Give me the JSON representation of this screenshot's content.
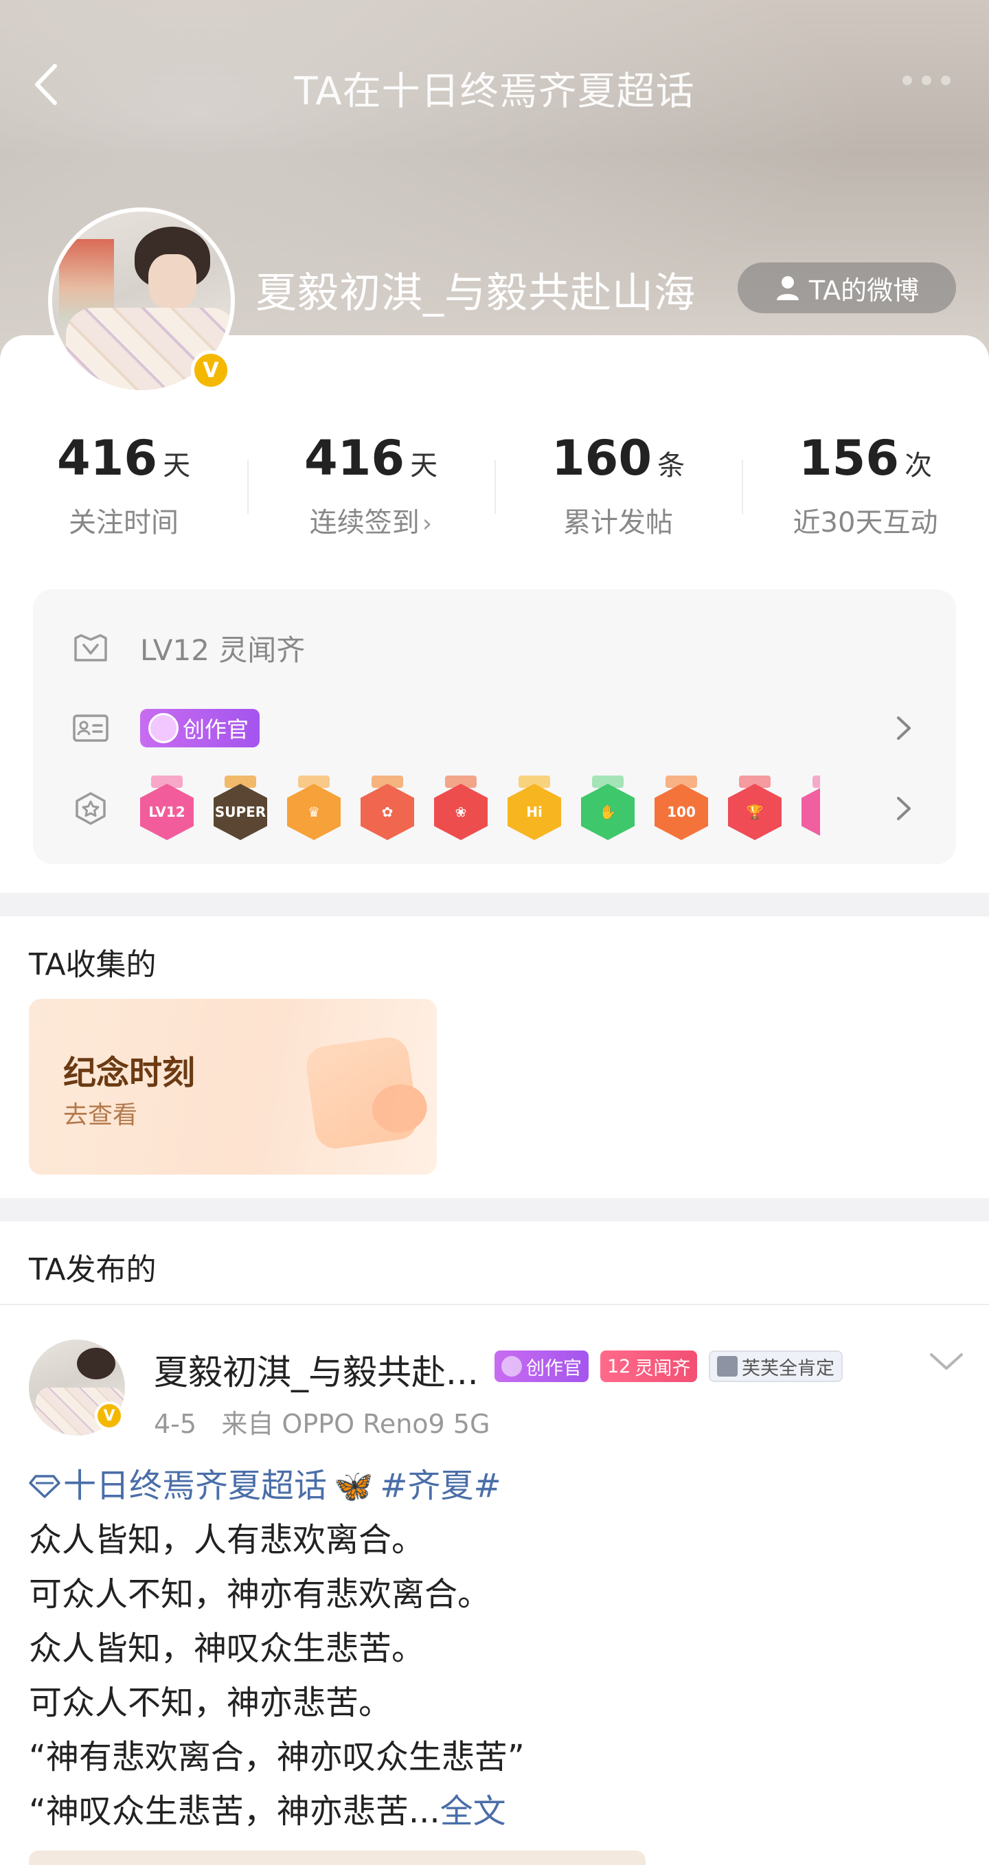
{
  "header": {
    "title": "TA在十日终焉齐夏超话"
  },
  "profile": {
    "name": "夏毅初淇_与毅共赴山海",
    "weibo_button_label": "TA的微博",
    "verified_mark": "V"
  },
  "stats": [
    {
      "value": "416",
      "unit": "天",
      "label": "关注时间",
      "has_arrow": false
    },
    {
      "value": "416",
      "unit": "天",
      "label": "连续签到",
      "has_arrow": true,
      "arrow": "›"
    },
    {
      "value": "160",
      "unit": "条",
      "label": "累计发帖",
      "has_arrow": false
    },
    {
      "value": "156",
      "unit": "次",
      "label": "近30天互动",
      "has_arrow": false
    }
  ],
  "level": {
    "text": "LV12 灵闻齐",
    "creator_tag": "创作官",
    "medals": [
      {
        "icon": "lv12-medal",
        "text": "LV12",
        "color": "#f25c9a",
        "ribbon": "#f7a7c8"
      },
      {
        "icon": "super-crown-medal",
        "text": "SUPER",
        "color": "#5a4632",
        "ribbon": "#f2b96a"
      },
      {
        "icon": "crown-medal",
        "text": "♛",
        "color": "#f6a13a",
        "ribbon": "#f9c98a"
      },
      {
        "icon": "mascot-medal",
        "text": "✿",
        "color": "#f0664e",
        "ribbon": "#f5b37f"
      },
      {
        "icon": "mascot-girl-medal",
        "text": "❀",
        "color": "#ee4d4d",
        "ribbon": "#f3a58a"
      },
      {
        "icon": "hi-medal",
        "text": "Hi",
        "color": "#f7b51f",
        "ribbon": "#f9d27e"
      },
      {
        "icon": "hand-medal",
        "text": "✋",
        "color": "#3fc76b",
        "ribbon": "#a4e4b7"
      },
      {
        "icon": "100-days-medal",
        "text": "100",
        "color": "#f4733a",
        "ribbon": "#f8b184"
      },
      {
        "icon": "trophy-medal",
        "text": "🏆",
        "color": "#ef4c55",
        "ribbon": "#f59a9f"
      },
      {
        "icon": "diamond-medal",
        "text": "◆",
        "color": "#f05fa0",
        "ribbon": "#f6aac9"
      }
    ]
  },
  "collections": {
    "title": "TA收集的",
    "card_title": "纪念时刻",
    "card_sub": "去查看"
  },
  "posts": {
    "title": "TA发布的",
    "item": {
      "author": "夏毅初淇_与毅共赴...",
      "badge_creator": "创作官",
      "badge_level_num": "12",
      "badge_level": "灵闻齐",
      "badge_praise": "芙芙全肯定",
      "date": "4-5",
      "source": "来自 OPPO Reno9 5G",
      "topic": "十日终焉齐夏超话",
      "hashtag": "#齐夏#",
      "lines": [
        "众人皆知，人有悲欢离合。",
        "可众人不知，神亦有悲欢离合。",
        "众人皆知，神叹众生悲苦。",
        "可众人不知，神亦悲苦。",
        "“神有悲欢离合，神亦叹众生悲苦”",
        "“神叹众生悲苦，神亦悲苦..."
      ],
      "full_text": "全文"
    }
  }
}
